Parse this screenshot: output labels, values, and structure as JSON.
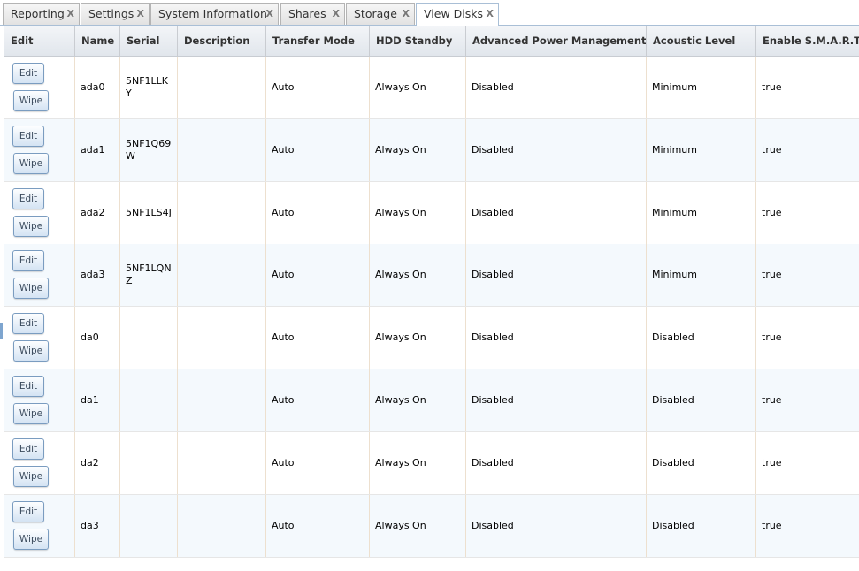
{
  "tabs": [
    {
      "label": "Reporting",
      "close": "X"
    },
    {
      "label": "Settings",
      "close": "X"
    },
    {
      "label": "System Information",
      "close": "X"
    },
    {
      "label": "Shares",
      "close": "X"
    },
    {
      "label": "Storage",
      "close": "X"
    },
    {
      "label": "View Disks",
      "close": "X",
      "active": true
    }
  ],
  "columns": [
    "Edit",
    "Name",
    "Serial",
    "Description",
    "Transfer Mode",
    "HDD Standby",
    "Advanced Power Management",
    "Acoustic Level",
    "Enable S.M.A.R.T."
  ],
  "buttons": {
    "edit": "Edit",
    "wipe": "Wipe"
  },
  "rows": [
    {
      "name": "ada0",
      "serial": "5NF1LLKY",
      "description": "",
      "transfer_mode": "Auto",
      "hdd_standby": "Always On",
      "apm": "Disabled",
      "acoustic": "Minimum",
      "smart": "true"
    },
    {
      "name": "ada1",
      "serial": "5NF1Q69W",
      "description": "",
      "transfer_mode": "Auto",
      "hdd_standby": "Always On",
      "apm": "Disabled",
      "acoustic": "Minimum",
      "smart": "true"
    },
    {
      "name": "ada2",
      "serial": "5NF1LS4J",
      "description": "",
      "transfer_mode": "Auto",
      "hdd_standby": "Always On",
      "apm": "Disabled",
      "acoustic": "Minimum",
      "smart": "true"
    },
    {
      "name": "ada3",
      "serial": "5NF1LQNZ",
      "description": "",
      "transfer_mode": "Auto",
      "hdd_standby": "Always On",
      "apm": "Disabled",
      "acoustic": "Minimum",
      "smart": "true"
    },
    {
      "name": "da0",
      "serial": "",
      "description": "",
      "transfer_mode": "Auto",
      "hdd_standby": "Always On",
      "apm": "Disabled",
      "acoustic": "Disabled",
      "smart": "true"
    },
    {
      "name": "da1",
      "serial": "",
      "description": "",
      "transfer_mode": "Auto",
      "hdd_standby": "Always On",
      "apm": "Disabled",
      "acoustic": "Disabled",
      "smart": "true"
    },
    {
      "name": "da2",
      "serial": "",
      "description": "",
      "transfer_mode": "Auto",
      "hdd_standby": "Always On",
      "apm": "Disabled",
      "acoustic": "Disabled",
      "smart": "true"
    },
    {
      "name": "da3",
      "serial": "",
      "description": "",
      "transfer_mode": "Auto",
      "hdd_standby": "Always On",
      "apm": "Disabled",
      "acoustic": "Disabled",
      "smart": "true"
    }
  ]
}
